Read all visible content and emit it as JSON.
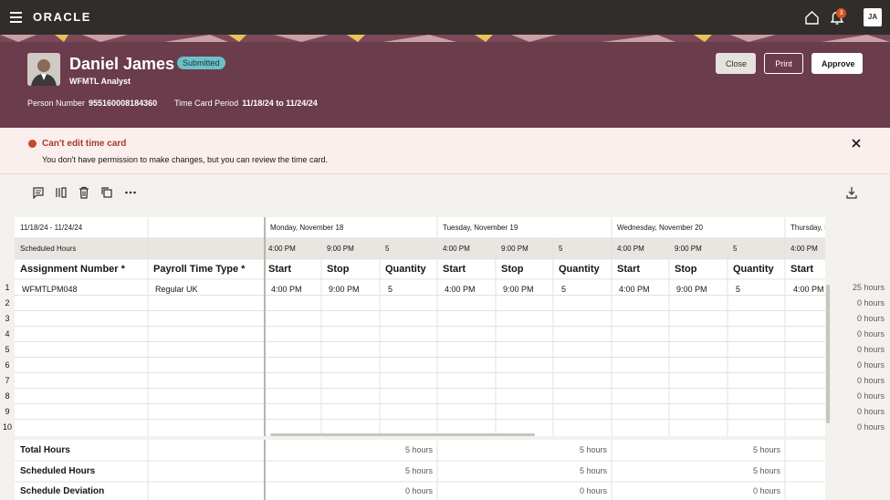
{
  "app": {
    "logo": "ORACLE",
    "notification_count": "3",
    "user_initials": "JA"
  },
  "person": {
    "name": "Daniel James",
    "status": "Submitted",
    "job": "WFMTL Analyst",
    "person_number_label": "Person Number",
    "person_number": "955160008184360",
    "period_label": "Time Card Period",
    "period": "11/18/24 to 11/24/24"
  },
  "actions": {
    "close": "Close",
    "print": "Print",
    "approve": "Approve"
  },
  "banner": {
    "title": "Can't edit time card",
    "message": "You don't have permission to make changes, but you can review the time card."
  },
  "grid": {
    "range": "11/18/24 - 11/24/24",
    "scheduled_label": "Scheduled Hours",
    "days": [
      "Monday, November 18",
      "Tuesday, November 19",
      "Wednesday, November 20",
      "Thursday, N"
    ],
    "scheduled": [
      [
        "4:00 PM",
        "9:00 PM",
        "5"
      ],
      [
        "4:00 PM",
        "9:00 PM",
        "5"
      ],
      [
        "4:00 PM",
        "9:00 PM",
        "5"
      ],
      [
        "4:00 PM"
      ]
    ],
    "col_assignment": "Assignment Number *",
    "col_payroll": "Payroll Time Type *",
    "sub_headers": [
      "Start",
      "Stop",
      "Quantity",
      "Start",
      "Stop",
      "Quantity",
      "Start",
      "Stop",
      "Quantity",
      "Start"
    ],
    "row1": {
      "assignment": "WFMTLPM048",
      "payroll": "Regular UK",
      "values": [
        "4:00 PM",
        "9:00 PM",
        "5",
        "4:00 PM",
        "9:00 PM",
        "5",
        "4:00 PM",
        "9:00 PM",
        "5",
        "4:00 PM"
      ]
    },
    "row_numbers": [
      "1",
      "2",
      "3",
      "4",
      "5",
      "6",
      "7",
      "8",
      "9",
      "10"
    ],
    "row_totals": [
      "25 hours",
      "0 hours",
      "0 hours",
      "0 hours",
      "0 hours",
      "0 hours",
      "0 hours",
      "0 hours",
      "0 hours",
      "0 hours"
    ]
  },
  "summary": [
    {
      "label": "Total Hours",
      "values": [
        "5 hours",
        "5 hours",
        "5 hours"
      ]
    },
    {
      "label": "Scheduled Hours",
      "values": [
        "5 hours",
        "5 hours",
        "5 hours"
      ]
    },
    {
      "label": "Schedule Deviation",
      "values": [
        "0 hours",
        "0 hours",
        "0 hours"
      ]
    }
  ],
  "colors": {
    "topbar": "#312d2a",
    "header": "#6b3c4b",
    "status_badge": "#6cc0c7",
    "error": "#c74634"
  },
  "icons": {
    "menu": "hamburger-icon",
    "home": "home-icon",
    "notifications": "bell-icon",
    "comment": "comment-icon",
    "columns": "columns-icon",
    "delete": "delete-icon",
    "copy": "copy-icon",
    "more": "more-icon",
    "download": "download-icon"
  }
}
